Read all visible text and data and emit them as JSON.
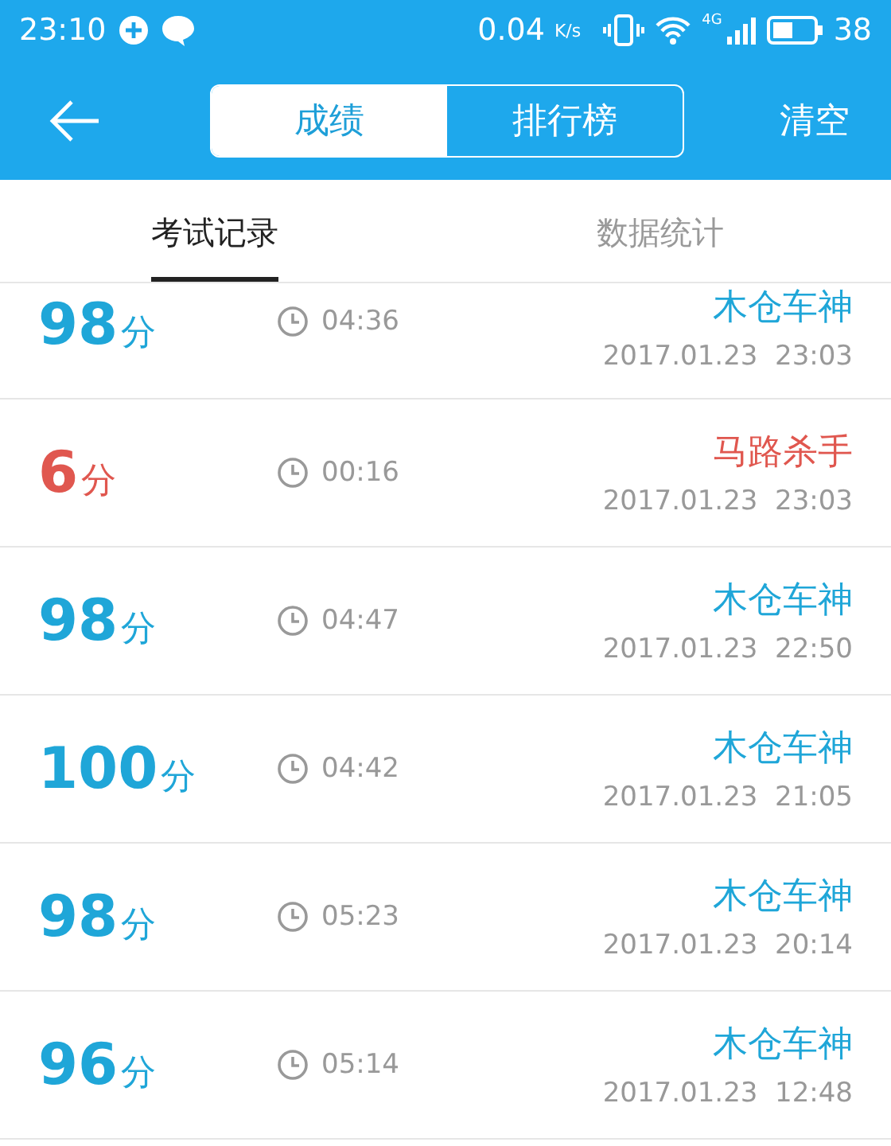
{
  "status_bar": {
    "time": "23:10",
    "speed": "0.04",
    "speed_unit": "K/s",
    "network": "4G",
    "battery": "38"
  },
  "app_bar": {
    "segments": [
      {
        "label": "成绩",
        "selected": true
      },
      {
        "label": "排行榜",
        "selected": false
      }
    ],
    "action": "清空"
  },
  "tabs": [
    {
      "label": "考试记录",
      "selected": true
    },
    {
      "label": "数据统计",
      "selected": false
    }
  ],
  "records": [
    {
      "score": "98",
      "unit": "分",
      "duration": "04:36",
      "title": "木仓车神",
      "date": "2017.01.23  23:03",
      "color": "#1fa6d8"
    },
    {
      "score": "6",
      "unit": "分",
      "duration": "00:16",
      "title": "马路杀手",
      "date": "2017.01.23  23:03",
      "color": "#e0574f"
    },
    {
      "score": "98",
      "unit": "分",
      "duration": "04:47",
      "title": "木仓车神",
      "date": "2017.01.23  22:50",
      "color": "#1fa6d8"
    },
    {
      "score": "100",
      "unit": "分",
      "duration": "04:42",
      "title": "木仓车神",
      "date": "2017.01.23  21:05",
      "color": "#1fa6d8"
    },
    {
      "score": "98",
      "unit": "分",
      "duration": "05:23",
      "title": "木仓车神",
      "date": "2017.01.23  20:14",
      "color": "#1fa6d8"
    },
    {
      "score": "96",
      "unit": "分",
      "duration": "05:14",
      "title": "木仓车神",
      "date": "2017.01.23  12:48",
      "color": "#1fa6d8"
    }
  ]
}
